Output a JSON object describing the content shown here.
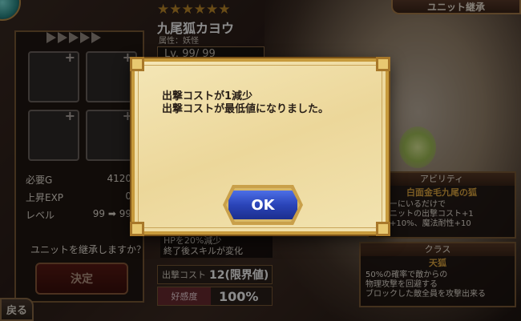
{
  "header": {
    "stars": "★★★★★★",
    "unit_name": "九尾狐カヨウ",
    "unit_attr": "属性：妖怪",
    "level": "Lv. 99/ 99",
    "tab_title": "ユニット継承"
  },
  "left_panel": {
    "stats": [
      {
        "label": "必要G",
        "value": "4120"
      },
      {
        "label": "上昇EXP",
        "value": "0"
      },
      {
        "label": "レベル",
        "value": "99 ➡ 99"
      }
    ],
    "question": "ユニットを継承しますか？",
    "decide_label": "決定",
    "back_label": "戻る"
  },
  "skill": {
    "line1": "HPを20%減少",
    "line2": "終了後スキルが変化"
  },
  "cost": {
    "label": "出撃コスト",
    "value": "12(限界値)"
  },
  "affinity": {
    "label": "好感度",
    "value": "100%"
  },
  "ability": {
    "head": "アビリティ",
    "name": "白面金毛九尾の狐",
    "lines": [
      "ンバーにいるだけで",
      "性ユニットの出撃コスト+1",
      "防御+10%、魔法耐性+10"
    ]
  },
  "class_info": {
    "head": "クラス",
    "name": "天狐",
    "lines": [
      "50%の確率で敵からの",
      "物理攻撃を回避する",
      "ブロックした敵全員を攻撃出来る"
    ]
  },
  "modal": {
    "line1": "出撃コストが1減少",
    "line2": "出撃コストが最低値になりました。",
    "ok_label": "OK"
  }
}
